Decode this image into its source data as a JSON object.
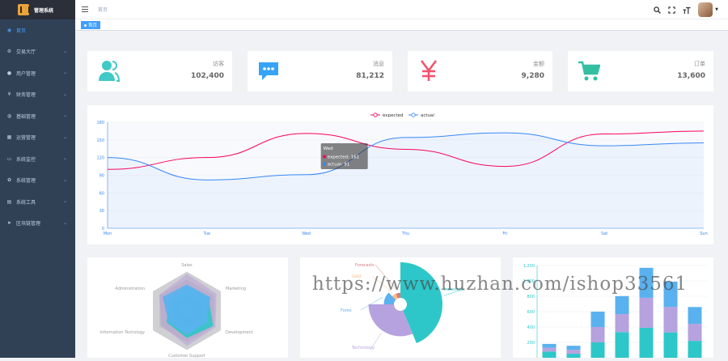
{
  "app": {
    "title": "管理系统"
  },
  "sidebar": {
    "items": [
      {
        "label": "首页",
        "icon": "dashboard-icon",
        "glyph": "◉",
        "active": true
      },
      {
        "label": "交易大厅",
        "icon": "gear-icon",
        "glyph": "⚙"
      },
      {
        "label": "用户管理",
        "icon": "user-icon",
        "glyph": "●"
      },
      {
        "label": "财务管理",
        "icon": "yen-icon",
        "glyph": "¥"
      },
      {
        "label": "基础管理",
        "icon": "globe-icon",
        "glyph": "◍"
      },
      {
        "label": "运营管理",
        "icon": "grid-icon",
        "glyph": "▦"
      },
      {
        "label": "系统监控",
        "icon": "monitor-icon",
        "glyph": "▭"
      },
      {
        "label": "系统管理",
        "icon": "settings-icon",
        "glyph": "✿"
      },
      {
        "label": "系统工具",
        "icon": "tool-icon",
        "glyph": "▤"
      },
      {
        "label": "区块链管理",
        "icon": "send-icon",
        "glyph": "➤"
      }
    ]
  },
  "navbar": {
    "breadcrumb": "首页",
    "icons": [
      "search-icon",
      "fullscreen-icon",
      "font-size-icon"
    ]
  },
  "tags": [
    {
      "label": "首页"
    }
  ],
  "stats": [
    {
      "label": "访客",
      "value": "102,400",
      "icon": "people-icon",
      "color": "#40c9c6"
    },
    {
      "label": "消息",
      "value": "81,212",
      "icon": "message-icon",
      "color": "#36a3f7"
    },
    {
      "label": "金额",
      "value": "9,280",
      "icon": "money-icon",
      "color": "#f4516c"
    },
    {
      "label": "订单",
      "value": "13,600",
      "icon": "shopping-icon",
      "color": "#34bfa3"
    }
  ],
  "chart_data": [
    {
      "type": "line",
      "x": [
        "Mon",
        "Tue",
        "Wed",
        "Thu",
        "Fri",
        "Sat",
        "Sun"
      ],
      "ylim": [
        0,
        180
      ],
      "yticks": [
        "0",
        "30",
        "60",
        "90",
        "120",
        "150",
        "180"
      ],
      "series": [
        {
          "name": "expected",
          "values": [
            100,
            120,
            161,
            134,
            105,
            160,
            165
          ],
          "color": "#ff005a"
        },
        {
          "name": "actual",
          "values": [
            120,
            82,
            91,
            154,
            162,
            140,
            145
          ],
          "color": "#3888fa"
        }
      ],
      "legend": "top-center",
      "tooltip": {
        "title": "Wed",
        "lines": [
          "expected: 161",
          "actual: 91"
        ]
      }
    },
    {
      "type": "radar",
      "indicators": [
        "Sales",
        "Administration",
        "Information Techology",
        "Customer Support",
        "Development",
        "Marketing"
      ],
      "colors": [
        "#b9a3d6",
        "#2ec7c9",
        "#5ab1ef"
      ]
    },
    {
      "type": "pie",
      "categories": [
        "Industries",
        "Technology",
        "Forex",
        "Gold",
        "Forecasts"
      ],
      "values": [
        35,
        25,
        10,
        5,
        5
      ],
      "colors": [
        "#2ec7c9",
        "#b6a2de",
        "#5ab1ef",
        "#ffb980",
        "#d87a80"
      ]
    },
    {
      "type": "bar",
      "stacked": true,
      "yticks": [
        "200",
        "400",
        "600",
        "800",
        "1,000",
        "1,200"
      ],
      "ylim": [
        0,
        1200
      ],
      "series": [
        {
          "values": [
            80,
            52,
            200,
            334,
            390,
            330,
            220
          ],
          "color": "#2ec7c9"
        },
        {
          "values": [
            50,
            52,
            200,
            234,
            390,
            330,
            220
          ],
          "color": "#b6a2de"
        },
        {
          "values": [
            50,
            52,
            200,
            234,
            390,
            330,
            220
          ],
          "color": "#5ab1ef"
        }
      ]
    }
  ],
  "watermark": "https://www.huzhan.com/ishop33561"
}
